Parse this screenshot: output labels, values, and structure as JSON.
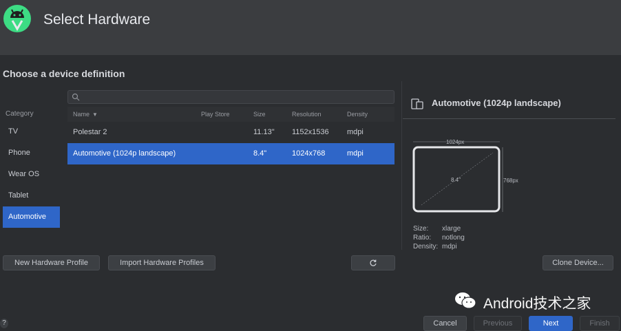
{
  "window": {
    "title": "Select Hardware"
  },
  "section": {
    "title": "Choose a device definition"
  },
  "categories": {
    "header": "Category",
    "items": [
      "TV",
      "Phone",
      "Wear OS",
      "Tablet",
      "Automotive"
    ],
    "selected": "Automotive"
  },
  "search": {
    "placeholder": ""
  },
  "table": {
    "columns": [
      "Name",
      "Play Store",
      "Size",
      "Resolution",
      "Density"
    ],
    "rows": [
      {
        "name": "Polestar 2",
        "play_store": "",
        "size": "11.13\"",
        "resolution": "1152x1536",
        "density": "mdpi"
      },
      {
        "name": "Automotive (1024p landscape)",
        "play_store": "",
        "size": "8.4\"",
        "resolution": "1024x768",
        "density": "mdpi"
      }
    ],
    "selected_index": 1
  },
  "preview": {
    "title": "Automotive (1024p landscape)",
    "width_label": "1024px",
    "height_label": "768px",
    "diagonal_label": "8.4\"",
    "specs": [
      {
        "key": "Size:",
        "value": "xlarge"
      },
      {
        "key": "Ratio:",
        "value": "notlong"
      },
      {
        "key": "Density:",
        "value": "mdpi"
      }
    ]
  },
  "buttons": {
    "new_profile": "New Hardware Profile",
    "import_profiles": "Import Hardware Profiles",
    "clone_device": "Clone Device...",
    "cancel": "Cancel",
    "previous": "Previous",
    "next": "Next",
    "finish": "Finish",
    "help": "?"
  },
  "watermark": {
    "text": "Android技术之家"
  },
  "colors": {
    "accent": "#2f66c8",
    "background": "#2b2d30",
    "header": "#3b3d40"
  },
  "icons": [
    "android-studio-logo",
    "search-icon",
    "sort-arrow-icon",
    "refresh-icon",
    "device-icon",
    "wechat-icon",
    "help-icon"
  ]
}
